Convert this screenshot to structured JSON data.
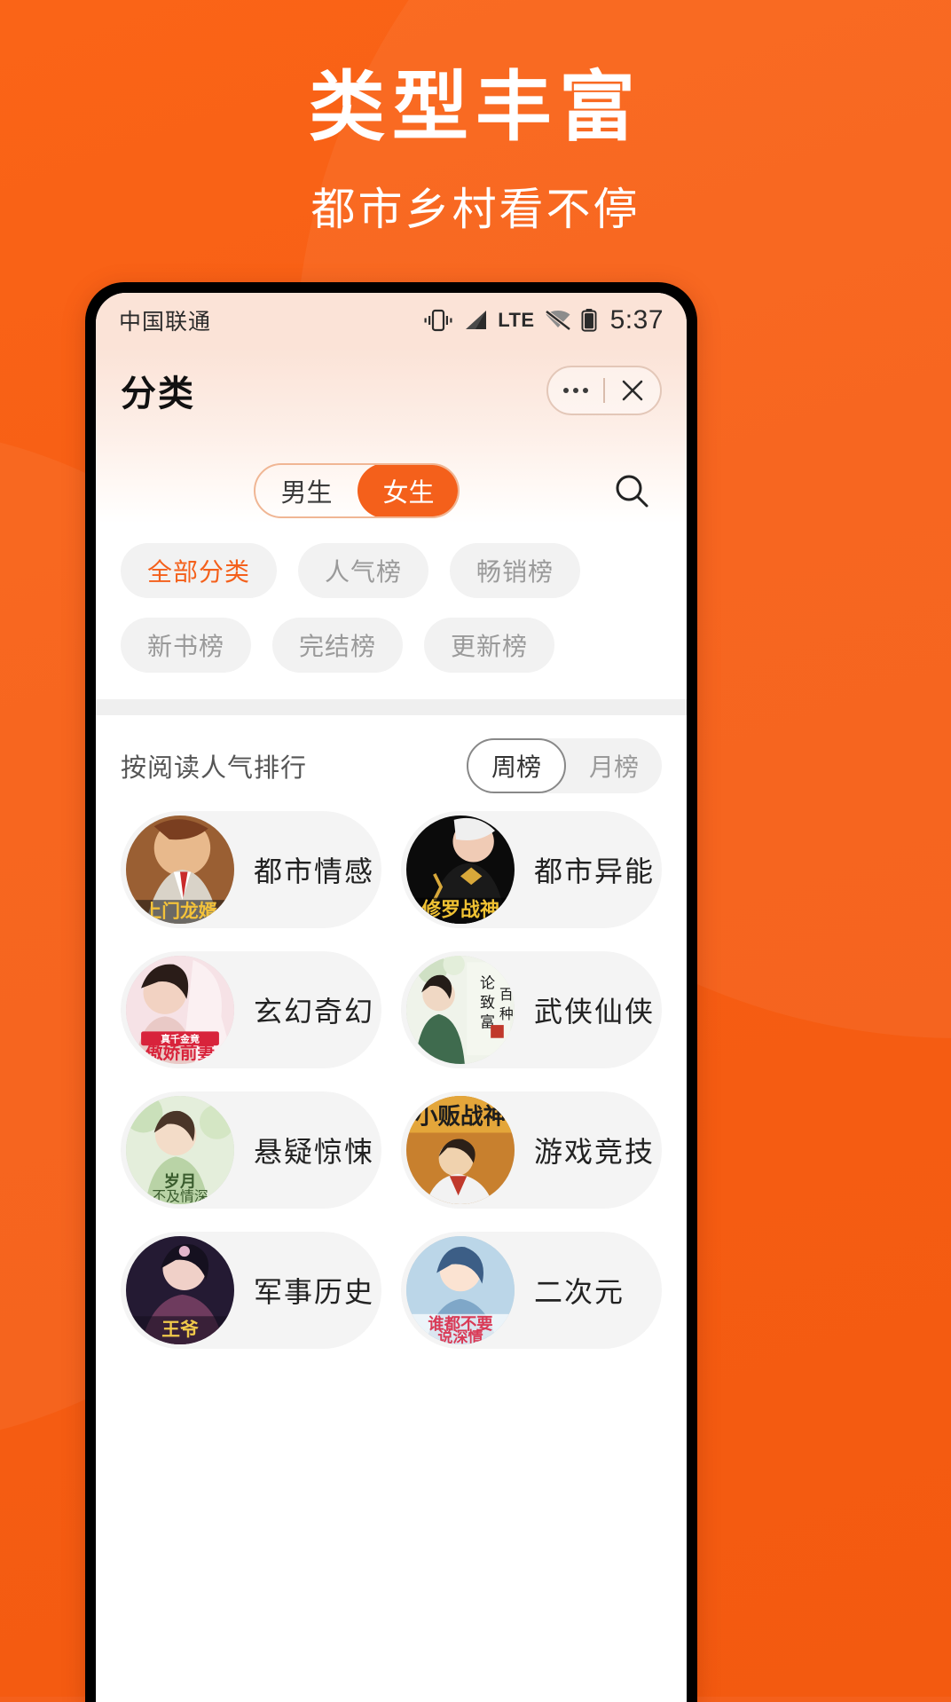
{
  "promo": {
    "title": "类型丰富",
    "subtitle": "都市乡村看不停"
  },
  "phone": {
    "statusbar": {
      "carrier": "中国联通",
      "time": "5:37",
      "network_label": "LTE",
      "icons": [
        "vibrate-icon",
        "signal-icon",
        "lte-label",
        "wifi-off-icon",
        "battery-icon"
      ]
    },
    "header": {
      "title": "分类",
      "more_label": "•••",
      "close_label": "✕"
    },
    "segment": {
      "options": [
        {
          "label": "男生",
          "active": false
        },
        {
          "label": "女生",
          "active": true
        }
      ],
      "search_icon": "search-icon"
    },
    "chips": [
      {
        "label": "全部分类",
        "active": true
      },
      {
        "label": "人气榜",
        "active": false
      },
      {
        "label": "畅销榜",
        "active": false
      },
      {
        "label": "新书榜",
        "active": false
      },
      {
        "label": "完结榜",
        "active": false
      },
      {
        "label": "更新榜",
        "active": false
      }
    ],
    "rank": {
      "title": "按阅读人气排行",
      "toggle": [
        {
          "label": "周榜",
          "active": true
        },
        {
          "label": "月榜",
          "active": false
        }
      ]
    },
    "categories": [
      {
        "label": "都市情感",
        "cover_colors": [
          "#C8854B",
          "#7A4A2A",
          "#E8C070"
        ],
        "cover_text": "上门龙婿"
      },
      {
        "label": "都市异能",
        "cover_colors": [
          "#121212",
          "#2A2A2A",
          "#E4B13A"
        ],
        "cover_text": "修罗战神"
      },
      {
        "label": "玄幻奇幻",
        "cover_colors": [
          "#F2D9DE",
          "#C9707E",
          "#E03A4A"
        ],
        "cover_text": "傲娇前妻抱回家"
      },
      {
        "label": "武侠仙侠",
        "cover_colors": [
          "#E7EFE2",
          "#7FA07A",
          "#3C5C3A"
        ],
        "cover_text": "论致富的一百种方法"
      },
      {
        "label": "悬疑惊悚",
        "cover_colors": [
          "#DDE8D6",
          "#9BB48C",
          "#5C7550"
        ],
        "cover_text": "岁月不及情深"
      },
      {
        "label": "游戏竞技",
        "cover_colors": [
          "#E8A43C",
          "#B8662A",
          "#F2D98C"
        ],
        "cover_text": "小贩战神"
      },
      {
        "label": "军事历史",
        "cover_colors": [
          "#2A1F3A",
          "#6B3C5C",
          "#D8A8C0"
        ],
        "cover_text": "王爷的娇宠王妃"
      },
      {
        "label": "二次元",
        "cover_colors": [
          "#BFD8E8",
          "#6F9CC0",
          "#E8506A"
        ],
        "cover_text": "谁都不要说深情"
      }
    ]
  },
  "colors": {
    "brand_orange": "#F4601B",
    "promo_bg": "#F75E14",
    "chip_bg": "#F2F2F2",
    "chip_text": "#9a9a9a",
    "statusbar_bg": "#FBE3D7"
  }
}
